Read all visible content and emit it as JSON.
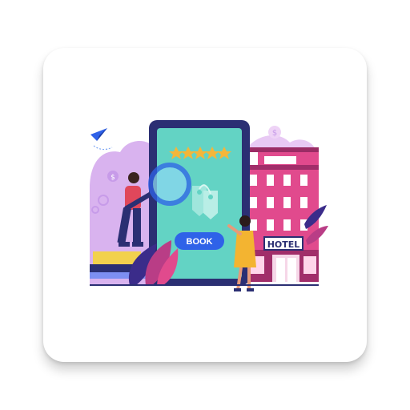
{
  "app_icon": {
    "book_button_label": "BOOK",
    "hotel_sign_text": "HOTEL",
    "rating_stars": 5
  },
  "icons": [
    "paper-plane-icon",
    "dollar-coin-icon",
    "gear-icon",
    "magnifier-icon",
    "key-icon",
    "star-icon"
  ],
  "colors": {
    "phone_frame": "#2b2f73",
    "phone_screen": "#63d3c4",
    "book_button": "#2f62e8",
    "hotel_facade": "#e14a8d",
    "accent_purple": "#b77be0",
    "star": "#f4b63a"
  }
}
